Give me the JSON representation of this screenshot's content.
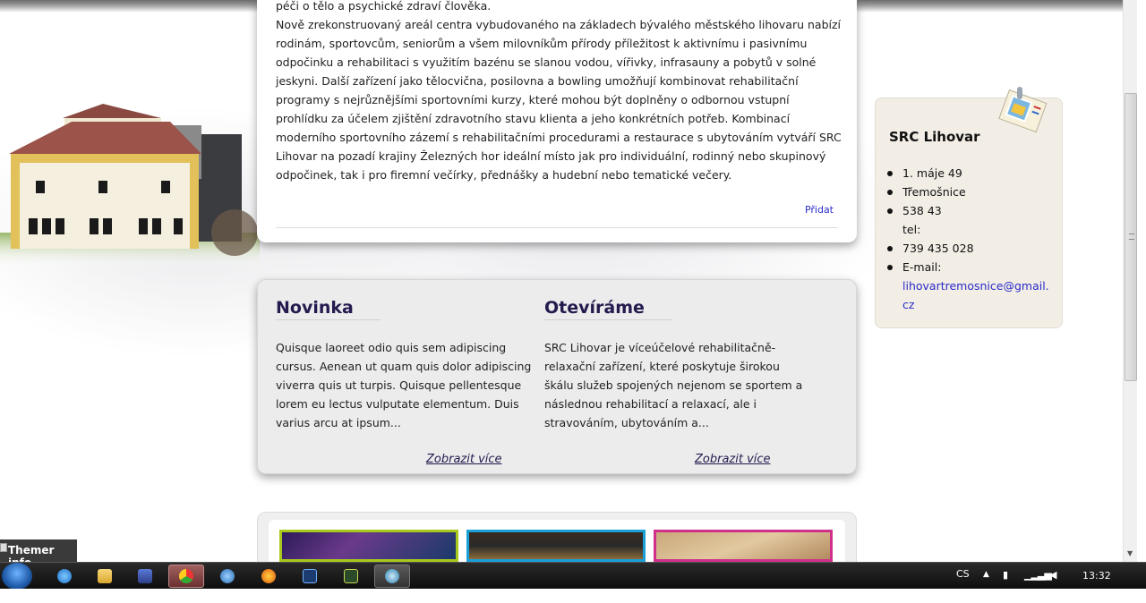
{
  "content": {
    "paragraphs": [
      "péči o tělo a psychické zdraví člověka.",
      "Nově zrekonstruovaný areál centra vybudovaného na základech bývalého městského lihovaru nabízí rodinám, sportovcům, seniorům a všem milovníkům přírody příležitost k aktivnímu i pasivnímu odpočinku a rehabilitaci s využitím bazénu se slanou vodou, vířivky, infrasauny a pobytů v solné jeskyni. Další zařízení jako tělocvična, posilovna a bowling umožňují kombinovat rehabilitační programy s nejrůznějšími sportovními kurzy, které mohou být doplněny o odbornou vstupní prohlídku za účelem zjištění zdravotního stavu klienta a jeho konkrétních potřeb. Kombinací moderního sportovního zázemí s rehabilitačními procedurami a restaurace s ubytováním vytváří SRC Lihovar na pozadí krajiny Železných hor ideální místo jak pro individuální, rodinný nebo skupinový odpočinek, tak i pro firemní večírky, přednášky a hudební nebo tematické večery."
    ],
    "add_label": "Přidat"
  },
  "news": {
    "left": {
      "title": "Novinka",
      "body": "Quisque laoreet odio quis sem adipiscing cursus. Aenean ut quam quis dolor adipiscing viverra quis ut turpis. Quisque pellentesque lorem eu lectus vulputate elementum. Duis varius arcu at ipsum...",
      "more": "Zobrazit více"
    },
    "right": {
      "title": "Otevíráme",
      "body": "SRC Lihovar je víceúčelové rehabilitačně-relaxační zařízení, které poskytuje širokou škálu služeb spojených nejenom se sportem a následnou rehabilitací a relaxací, ale i stravováním, ubytováním a...",
      "more": "Zobrazit více"
    }
  },
  "contact": {
    "title": "SRC Lihovar",
    "street": "1. máje 49",
    "city": "Třemošnice",
    "zip": "538 43",
    "tel_label": "tel:",
    "tel": "739 435 028",
    "email_label": "E-mail:",
    "email": "lihovartremosnice@gmail.cz"
  },
  "gallery": {
    "border_colors": [
      "#a8c81e",
      "#1aa0d8",
      "#d0308a"
    ]
  },
  "themer": {
    "label": "Themer info"
  },
  "taskbar": {
    "language": "CS",
    "clock": "13:32",
    "apps": [
      "internet-explorer-icon",
      "folder-icon",
      "save-icon",
      "chrome-icon",
      "globe-icon",
      "firefox-icon",
      "photoshop-icon",
      "fireworks-icon",
      "dreamweaver-icon"
    ]
  },
  "colors": {
    "heading": "#241a4e",
    "link": "#2a2ac9",
    "contact_bg": "#f2eee6"
  }
}
